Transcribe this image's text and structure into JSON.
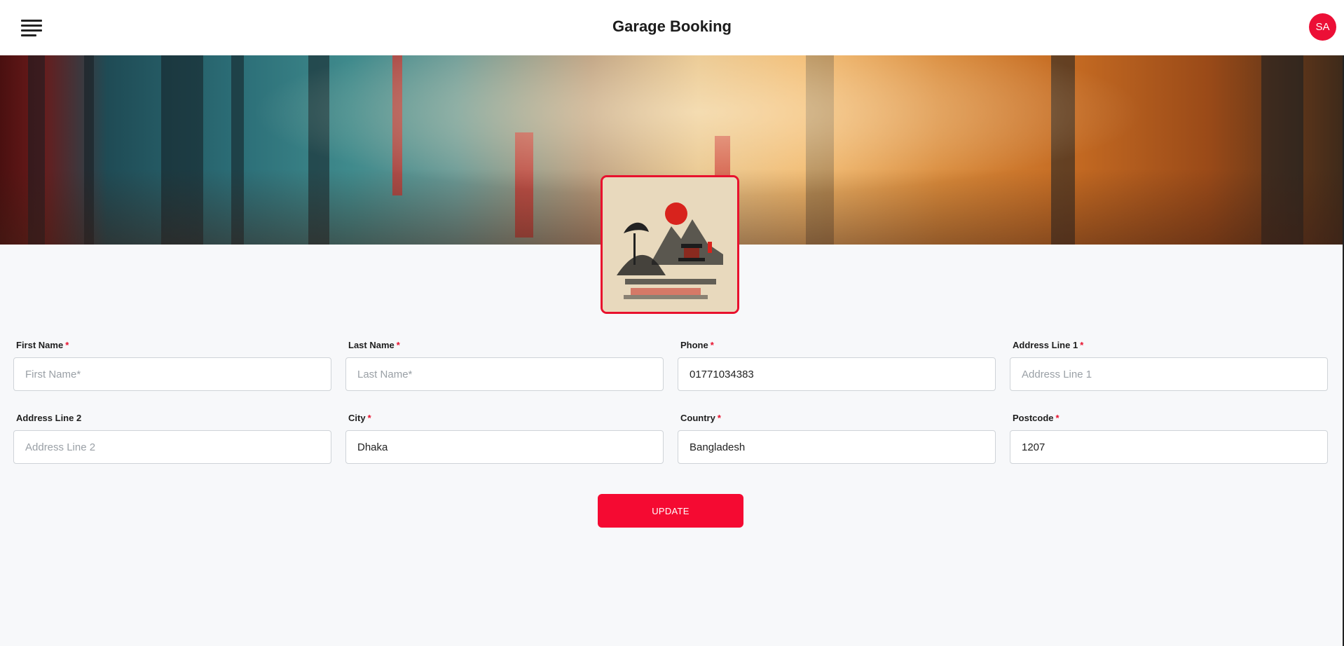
{
  "header": {
    "title": "Garage Booking",
    "avatar_initials": "SA",
    "menu_icon": "hamburger-menu-icon"
  },
  "colors": {
    "accent": "#f50a32",
    "avatar": "#ec0f36",
    "required_marker": "#e8112d"
  },
  "form": {
    "required_marker": "*",
    "fields": [
      {
        "label": "First Name",
        "required": true,
        "value": "",
        "placeholder": "First Name*"
      },
      {
        "label": "Last Name",
        "required": true,
        "value": "",
        "placeholder": "Last Name*"
      },
      {
        "label": "Phone",
        "required": true,
        "value": "01771034383",
        "placeholder": ""
      },
      {
        "label": "Address Line 1",
        "required": true,
        "value": "",
        "placeholder": "Address Line 1"
      },
      {
        "label": "Address Line 2",
        "required": false,
        "value": "",
        "placeholder": "Address Line 2"
      },
      {
        "label": "City",
        "required": true,
        "value": "Dhaka",
        "placeholder": ""
      },
      {
        "label": "Country",
        "required": true,
        "value": "Bangladesh",
        "placeholder": ""
      },
      {
        "label": "Postcode",
        "required": true,
        "value": "1207",
        "placeholder": ""
      }
    ],
    "submit_label": "UPDATE"
  }
}
